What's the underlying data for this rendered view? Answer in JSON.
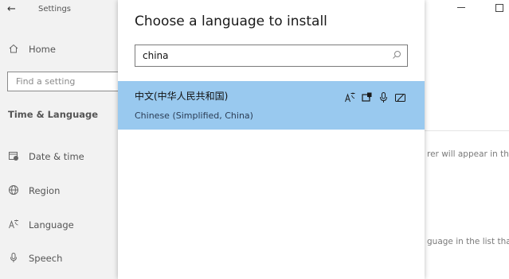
{
  "window": {
    "title": "Settings"
  },
  "sidebar": {
    "home_label": "Home",
    "search_placeholder": "Find a setting",
    "section_heading": "Time & Language",
    "items": [
      {
        "label": "Date & time",
        "icon": "calendar-clock-icon"
      },
      {
        "label": "Region",
        "icon": "globe-icon"
      },
      {
        "label": "Language",
        "icon": "language-icon"
      },
      {
        "label": "Speech",
        "icon": "microphone-icon"
      }
    ]
  },
  "page": {
    "text_line1": "rer will appear in thi",
    "text_line2": "guage in the list that"
  },
  "dialog": {
    "title": "Choose a language to install",
    "search_value": "china",
    "results": [
      {
        "native_name": "中文(中华人民共和国)",
        "english_name": "Chinese (Simplified, China)",
        "selected": true,
        "feature_icons": [
          "display-language-icon",
          "text-to-speech-icon",
          "speech-recognition-icon",
          "handwriting-icon"
        ]
      }
    ]
  },
  "colors": {
    "selection": "#99c9ef",
    "sidebar_bg": "#f2f2f2"
  }
}
